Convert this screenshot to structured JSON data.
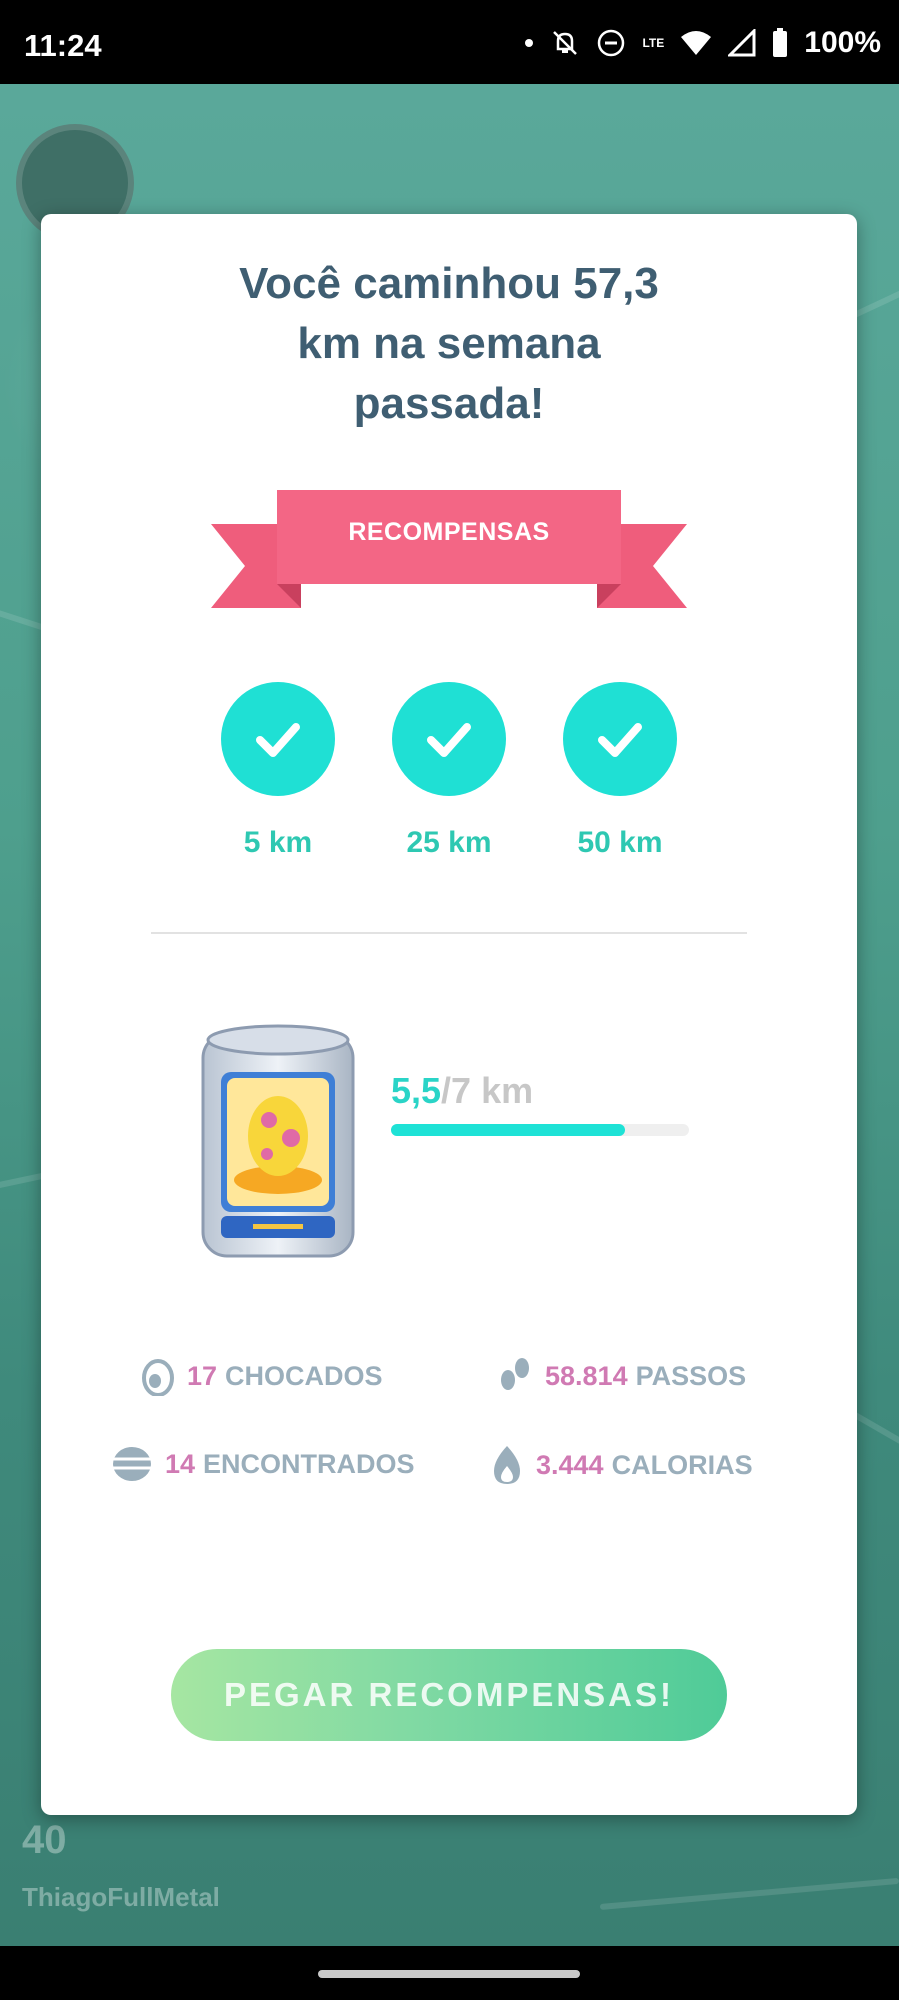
{
  "status_bar": {
    "time": "11:24",
    "battery": "100%",
    "icons": [
      "dot-icon",
      "bell-off-icon",
      "do-not-disturb-icon",
      "volte-icon",
      "wifi-icon",
      "signal-icon",
      "battery-icon"
    ],
    "volte_label": "LTE"
  },
  "map": {
    "level": "40",
    "username": "ThiagoFullMetal"
  },
  "modal": {
    "title_lines": [
      "Você caminhou 57,3",
      "km na semana",
      "passada!"
    ],
    "ribbon_label": "RECOMPENSAS",
    "milestones": [
      {
        "label": "5 km",
        "completed": true
      },
      {
        "label": "25 km",
        "completed": true
      },
      {
        "label": "50 km",
        "completed": true
      }
    ],
    "progress": {
      "current": "5,5",
      "total": "/7 km",
      "fraction": 0.786
    },
    "stats": {
      "hatched": {
        "value": "17",
        "label": "CHOCADOS",
        "icon": "egg-icon"
      },
      "steps": {
        "value": "58.814",
        "label": "PASSOS",
        "icon": "footprints-icon"
      },
      "encountered": {
        "value": "14",
        "label": "ENCONTRADOS",
        "icon": "pokeball-icon"
      },
      "calories": {
        "value": "3.444",
        "label": "CALORIAS",
        "icon": "flame-icon"
      }
    },
    "cta_label": "PEGAR RECOMPENSAS!"
  },
  "colors": {
    "title": "#3f5e72",
    "ribbon": "#f36685",
    "check": "#1fe0d4",
    "milestone_text": "#2ec8b2",
    "stat_number": "#d07ab3",
    "stat_label": "#9aaebb"
  }
}
